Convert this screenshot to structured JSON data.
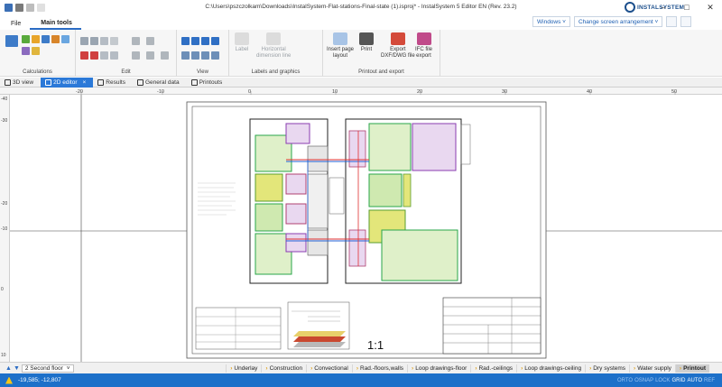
{
  "window": {
    "title": "C:\\Users\\pszczolkam\\Downloads\\InstalSystem-Flat-stations-Final-state (1).isproj* - InstalSystem 5 Editor EN (Rev. 23.2)",
    "logo_text": "INSTALSYSTEM"
  },
  "menu": {
    "file": "File",
    "main_tools": "Main tools"
  },
  "top_right": {
    "windows": "Windows ˅",
    "arrangement": "Change screen arrangement ˅"
  },
  "ribbon": {
    "groups": {
      "calculations": "Calculations",
      "edit": "Edit",
      "view": "View",
      "labels": "Labels and graphics",
      "printout": "Printout and export"
    },
    "label_btn": "Label",
    "dim_btn_1": "Horizontal",
    "dim_btn_2": "dimension line",
    "insert_page_1": "Insert page",
    "insert_page_2": "layout",
    "print": "Print",
    "export_1": "Export",
    "export_2": "DXF/DWG file",
    "ifc_1": "IFC file",
    "ifc_2": "export"
  },
  "doc_tabs": {
    "view3d": "3D view",
    "editor2d": "2D editor",
    "results": "Results",
    "general": "General data",
    "printouts": "Printouts",
    "close": "×"
  },
  "ruler": {
    "h": [
      "-20",
      "-10",
      "0",
      "10",
      "20",
      "30",
      "40",
      "50"
    ],
    "v": [
      "-40",
      "-30",
      "-20",
      "-10",
      "0",
      "10"
    ]
  },
  "drawing": {
    "scale": "1:1"
  },
  "bottom": {
    "floor": "2 Second floor",
    "tabs": [
      "Underlay",
      "Construction",
      "Convectional",
      "Rad.-floors,walls",
      "Loop drawings-floor",
      "Rad.-ceilings",
      "Loop drawings-ceiling",
      "Dry systems",
      "Water supply",
      "Printout"
    ]
  },
  "status": {
    "coords": "-19,585; -12,807",
    "modes": [
      "ORTO",
      "OSNAP",
      "LOCK",
      "GRID",
      "AUTO",
      "REF"
    ]
  },
  "colors": {
    "accent": "#2b79d8",
    "status_bar": "#1d70c9"
  }
}
